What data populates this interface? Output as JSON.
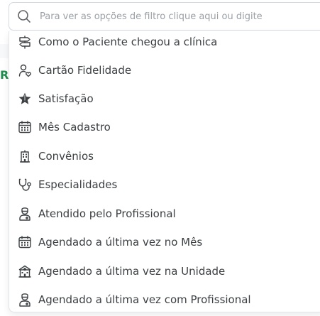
{
  "search": {
    "placeholder": "Para ver as opções de filtro clique aqui ou digite",
    "value": ""
  },
  "background": {
    "peek_letter": "R"
  },
  "options": [
    {
      "label": "Como o Paciente chegou a clínica",
      "icon": "signpost-icon"
    },
    {
      "label": "Cartão Fidelidade",
      "icon": "user-heart-icon"
    },
    {
      "label": "Satisfação",
      "icon": "star-icon"
    },
    {
      "label": "Mês Cadastro",
      "icon": "calendar-icon"
    },
    {
      "label": "Convênios",
      "icon": "building-icon"
    },
    {
      "label": "Especialidades",
      "icon": "stethoscope-icon"
    },
    {
      "label": "Atendido pelo Profissional",
      "icon": "doctor-icon"
    },
    {
      "label": "Agendado a última vez no Mês",
      "icon": "calendar-icon"
    },
    {
      "label": "Agendado a última vez na Unidade",
      "icon": "hospital-icon"
    },
    {
      "label": "Agendado a última vez com Profissional",
      "icon": "doctor-icon"
    }
  ]
}
